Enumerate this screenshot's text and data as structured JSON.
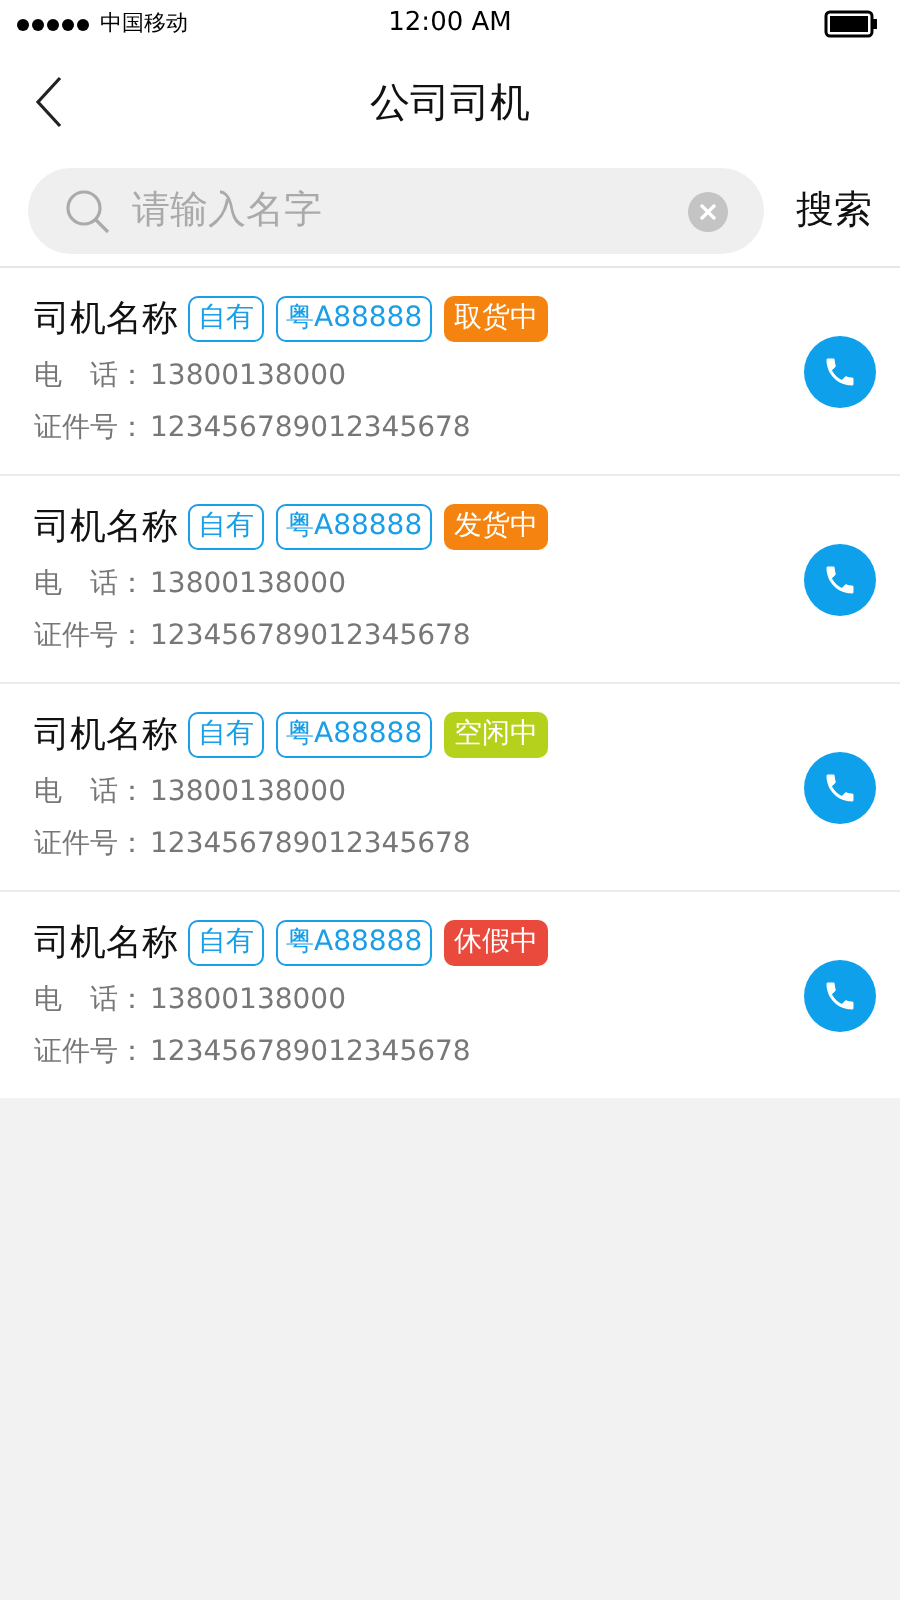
{
  "status_bar": {
    "carrier": "中国移动",
    "time": "12:00 AM"
  },
  "nav": {
    "title": "公司司机"
  },
  "search": {
    "placeholder": "请输入名字",
    "button": "搜索"
  },
  "drivers": [
    {
      "name": "司机名称",
      "ownership": "自有",
      "plate": "粤A88888",
      "status": "取货中",
      "color": "#f5830f",
      "phone_label": "电　话：",
      "phone": "13800138000",
      "id_label": "证件号：",
      "id": "123456789012345678"
    },
    {
      "name": "司机名称",
      "ownership": "自有",
      "plate": "粤A88888",
      "status": "发货中",
      "color": "#f5830f",
      "phone_label": "电　话：",
      "phone": "13800138000",
      "id_label": "证件号：",
      "id": "123456789012345678"
    },
    {
      "name": "司机名称",
      "ownership": "自有",
      "plate": "粤A88888",
      "status": "空闲中",
      "color": "#b6d11c",
      "phone_label": "电　话：",
      "phone": "13800138000",
      "id_label": "证件号：",
      "id": "123456789012345678"
    },
    {
      "name": "司机名称",
      "ownership": "自有",
      "plate": "粤A88888",
      "status": "休假中",
      "color": "#e94a3c",
      "phone_label": "电　话：",
      "phone": "13800138000",
      "id_label": "证件号：",
      "id": "123456789012345678"
    }
  ]
}
